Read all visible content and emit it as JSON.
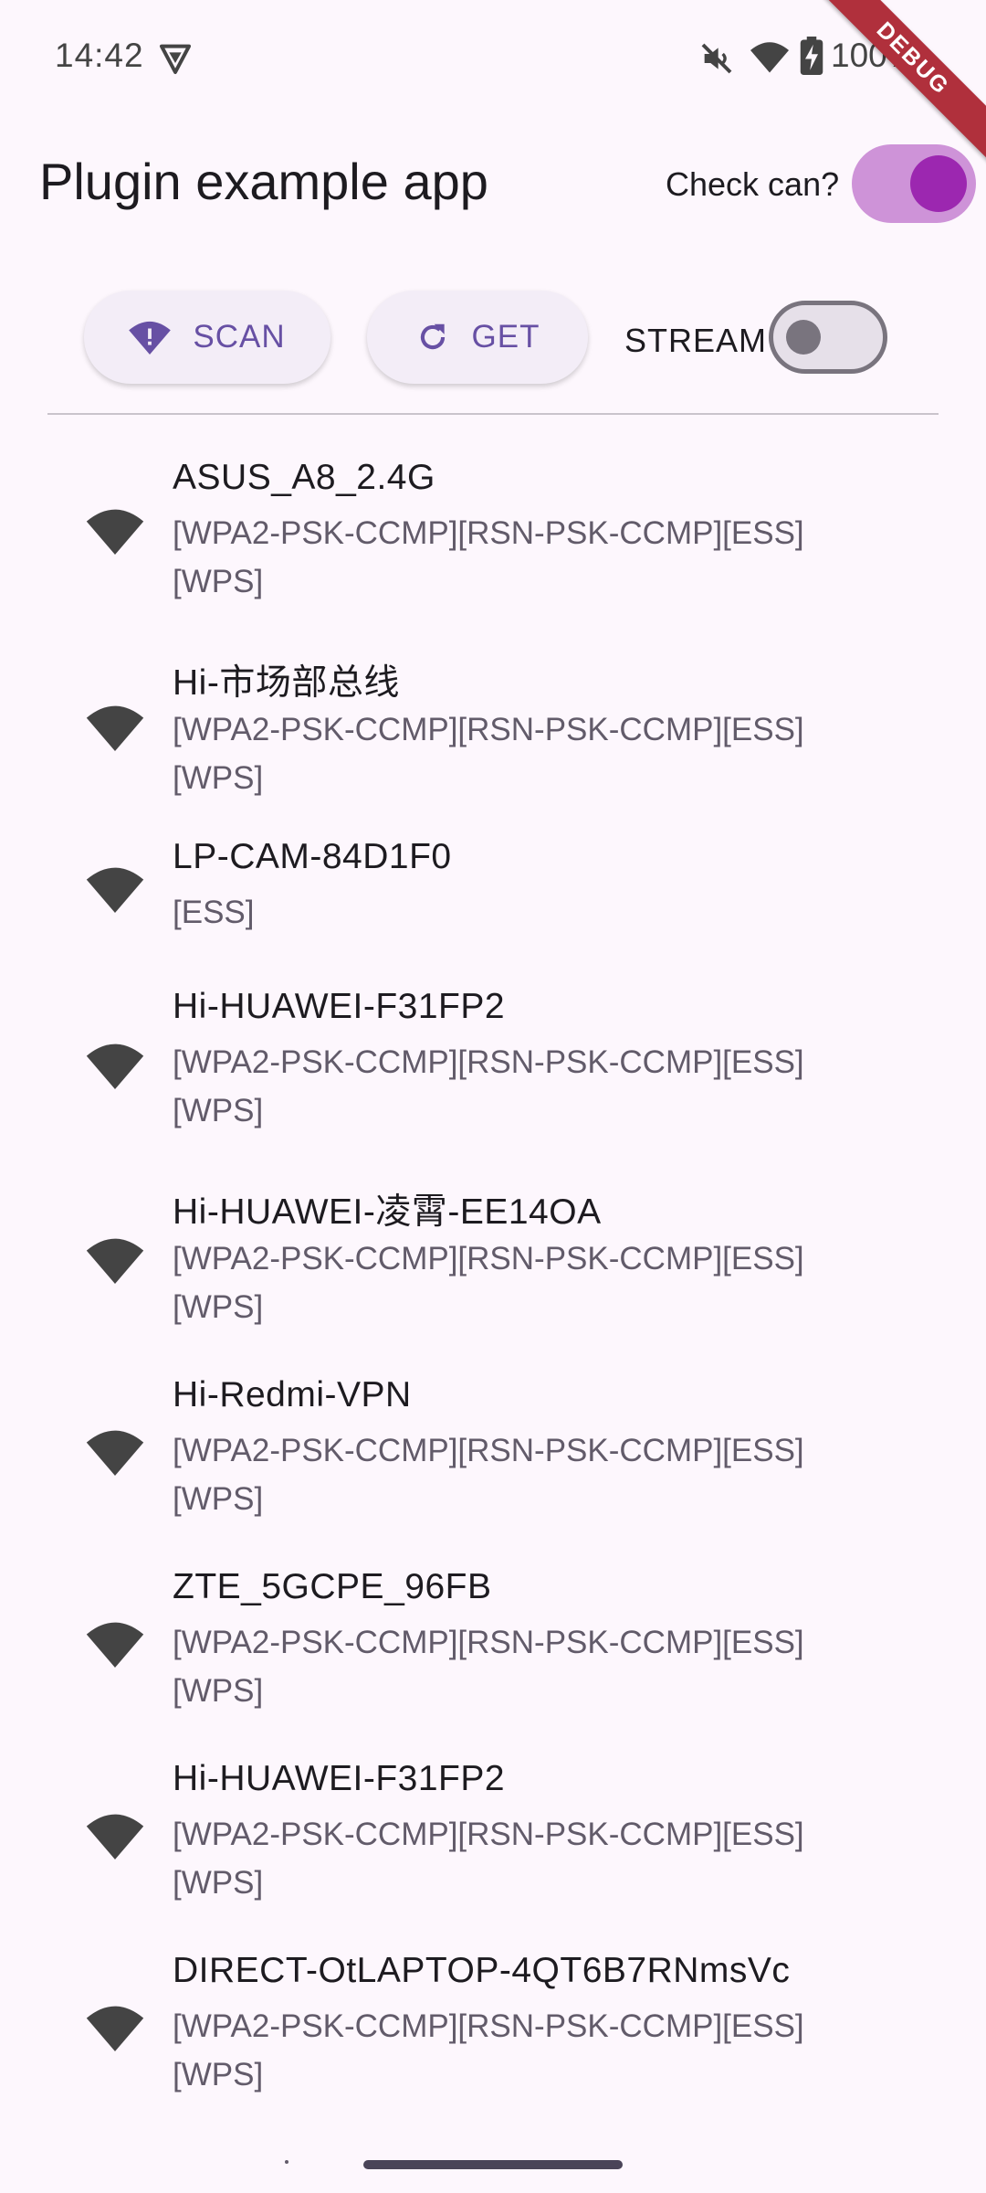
{
  "status_bar": {
    "time": "14:42",
    "battery": "100%",
    "icons": [
      "vpn-shield-icon",
      "mute-icon",
      "wifi-signal-icon",
      "battery-charging-icon"
    ]
  },
  "debug_banner": "DEBUG",
  "app_bar": {
    "title": "Plugin example app",
    "check_label": "Check can?",
    "check_enabled": true
  },
  "toolbar": {
    "scan_label": "SCAN",
    "get_label": "GET",
    "stream_label": "STREAM",
    "stream_enabled": false
  },
  "colors": {
    "accent": "#6750a4",
    "switch_on_track": "#ce93d8",
    "switch_on_thumb": "#9c27b0",
    "background": "#fdf7fd"
  },
  "networks": [
    {
      "ssid": "ASUS_A8_2.4G",
      "caps": "[WPA2-PSK-CCMP][RSN-PSK-CCMP][ESS] [WPS]"
    },
    {
      "ssid": "Hi-市场部总线",
      "caps": "[WPA2-PSK-CCMP][RSN-PSK-CCMP][ESS] [WPS]"
    },
    {
      "ssid": "LP-CAM-84D1F0",
      "caps": "[ESS]"
    },
    {
      "ssid": "Hi-HUAWEI-F31FP2",
      "caps": "[WPA2-PSK-CCMP][RSN-PSK-CCMP][ESS] [WPS]"
    },
    {
      "ssid": "Hi-HUAWEI-凌霄-EE14OA",
      "caps": "[WPA2-PSK-CCMP][RSN-PSK-CCMP][ESS] [WPS]"
    },
    {
      "ssid": "Hi-Redmi-VPN",
      "caps": "[WPA2-PSK-CCMP][RSN-PSK-CCMP][ESS] [WPS]"
    },
    {
      "ssid": "ZTE_5GCPE_96FB",
      "caps": "[WPA2-PSK-CCMP][RSN-PSK-CCMP][ESS] [WPS]"
    },
    {
      "ssid": "Hi-HUAWEI-F31FP2",
      "caps": "[WPA2-PSK-CCMP][RSN-PSK-CCMP][ESS] [WPS]"
    },
    {
      "ssid": "DIRECT-OtLAPTOP-4QT6B7RNmsVc",
      "caps": "[WPA2-PSK-CCMP][RSN-PSK-CCMP][ESS] [WPS]"
    }
  ]
}
